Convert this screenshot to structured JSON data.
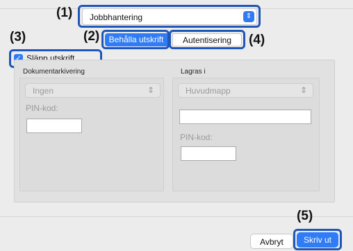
{
  "callouts": {
    "c1": "(1)",
    "c2": "(2)",
    "c3": "(3)",
    "c4": "(4)",
    "c5": "(5)"
  },
  "preset_select": {
    "value": "Jobbhantering",
    "icon": "updown-chevron-icon"
  },
  "tabs": {
    "retain": "Behålla utskrift",
    "auth": "Autentisering"
  },
  "release_checkbox": {
    "label": "Släpp utskrift",
    "checked": true,
    "icon": "checkmark-icon"
  },
  "document_filing": {
    "heading": "Dokumentarkivering",
    "select_value": "Ingen",
    "pin_label": "PIN-kod:"
  },
  "store_in": {
    "heading": "Lagras i",
    "select_value": "Huvudmapp",
    "pin_label": "PIN-kod:"
  },
  "buttons": {
    "cancel": "Avbryt",
    "print": "Skriv ut"
  },
  "colors": {
    "accent": "#2f7cf6",
    "callout_border": "#1f57b8"
  }
}
